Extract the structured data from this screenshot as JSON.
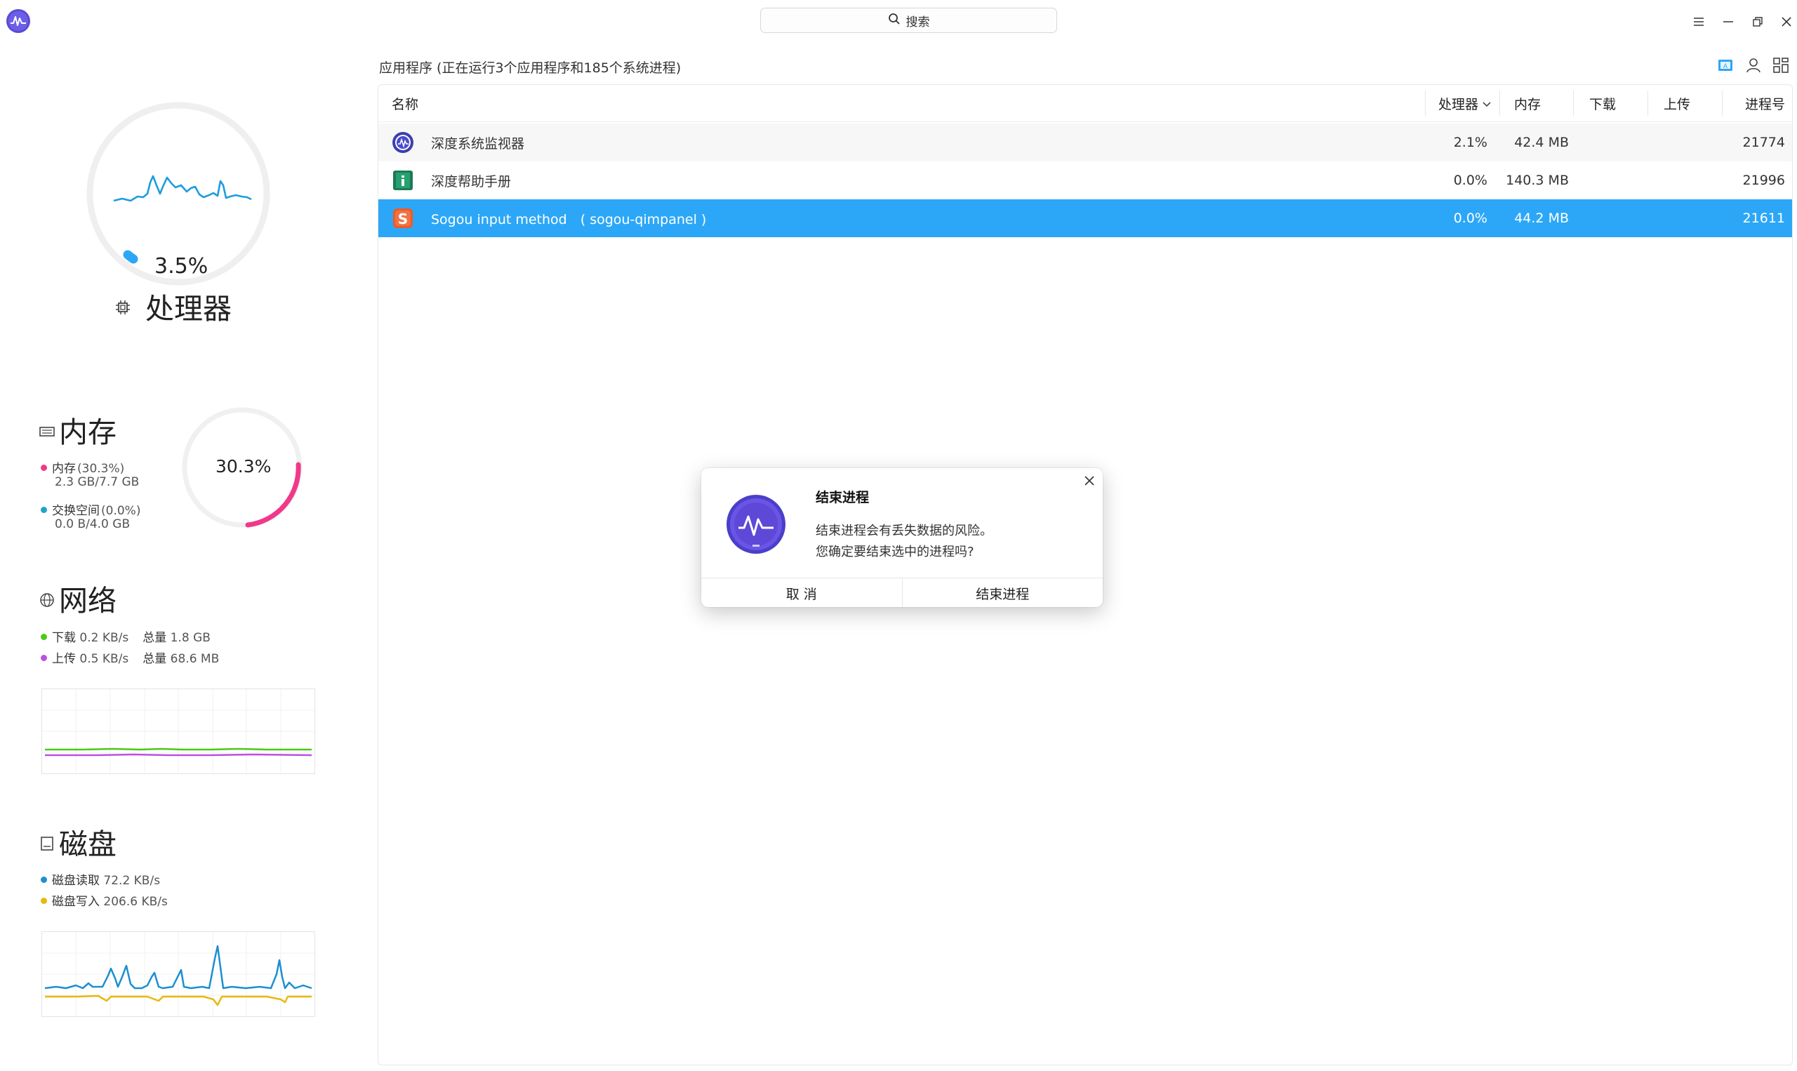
{
  "titlebar": {
    "search_placeholder": "搜索",
    "icons": [
      "app-logo-icon",
      "search-icon",
      "menu-icon",
      "minimize-icon",
      "restore-icon",
      "close-icon"
    ]
  },
  "cpu": {
    "percent_label": "3.5%",
    "percent": 3.5,
    "title": "处理器"
  },
  "memory": {
    "title": "内存",
    "mem_label": "内存",
    "mem_pct": "(30.3%)",
    "mem_value": "2.3 GB/7.7 GB",
    "swap_label": "交换空间",
    "swap_pct": "(0.0%)",
    "swap_value": "0.0 B/4.0 GB",
    "ring_label": "30.3%",
    "ring_percent": 30.3
  },
  "network": {
    "title": "网络",
    "download_label": "下载",
    "download_rate": "0.2 KB/s",
    "download_total_label": "总量",
    "download_total": "1.8 GB",
    "upload_label": "上传",
    "upload_rate": "0.5 KB/s",
    "upload_total_label": "总量",
    "upload_total": "68.6 MB"
  },
  "disk": {
    "title": "磁盘",
    "read_label": "磁盘读取",
    "read_rate": "72.2 KB/s",
    "write_label": "磁盘写入",
    "write_rate": "206.6 KB/s"
  },
  "colors": {
    "accent": "#2ca7f8",
    "memory": "#f0398a",
    "swap": "#1fa3c8",
    "download": "#4bc917",
    "upload": "#bd4fe3",
    "disk_read": "#1b8fd1",
    "disk_write": "#e8b80f"
  },
  "main": {
    "header": "应用程序 (正在运行3个应用程序和185个系统进程)",
    "columns": {
      "name": "名称",
      "cpu": "处理器",
      "memory": "内存",
      "download": "下载",
      "upload": "上传",
      "pid": "进程号"
    },
    "rows": [
      {
        "name": "深度系统监视器",
        "icon": "deepin-monitor-icon",
        "cpu": "2.1%",
        "memory": "42.4 MB",
        "download": "",
        "upload": "",
        "pid": "21774"
      },
      {
        "name": "深度帮助手册",
        "icon": "deepin-manual-icon",
        "cpu": "0.0%",
        "memory": "140.3 MB",
        "download": "",
        "upload": "",
        "pid": "21996"
      },
      {
        "name": "Sogou input method　( sogou-qimpanel )",
        "icon": "sogou-icon",
        "cpu": "0.0%",
        "memory": "44.2 MB",
        "download": "",
        "upload": "",
        "pid": "21611"
      }
    ]
  },
  "dialog": {
    "title": "结束进程",
    "line1": "结束进程会有丢失数据的风险。",
    "line2": "您确定要结束选中的进程吗?",
    "cancel": "取 消",
    "confirm": "结束进程"
  }
}
